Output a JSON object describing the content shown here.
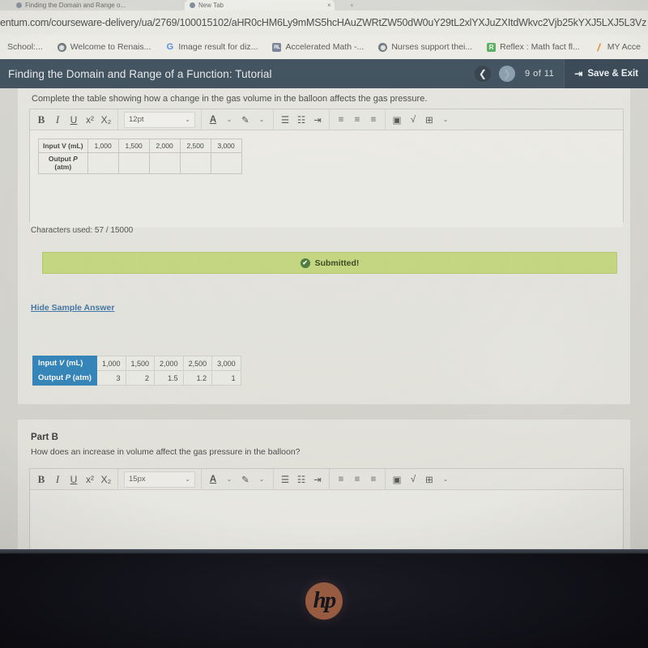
{
  "browser": {
    "tabs": [
      {
        "title": "Finding the Domain and Range o...",
        "active": false
      },
      {
        "title": "New Tab",
        "active": true
      }
    ],
    "url": "entum.com/courseware-delivery/ua/2769/100015102/aHR0cHM6Ly9mMS5hcHAuZWRtZW50dW0uY29tL2xlYXJuZXItdWkvc2Vjb25kYXJ5LXJ5L3Vz",
    "bookmarks": [
      {
        "label": "School:...",
        "icon": "none"
      },
      {
        "label": "Welcome to Renais...",
        "icon": "globe-icon"
      },
      {
        "label": "Image result for diz...",
        "icon": "google-icon"
      },
      {
        "label": "Accelerated Math -...",
        "icon": "renaissance-icon"
      },
      {
        "label": "Nurses support thei...",
        "icon": "globe-icon"
      },
      {
        "label": "Reflex : Math fact fl...",
        "icon": "reflex-icon"
      },
      {
        "label": "MY Acce",
        "icon": "slash-icon"
      }
    ]
  },
  "app_header": {
    "title": "Finding the Domain and Range of a Function: Tutorial",
    "back_icon": "chevron-left-icon",
    "next_icon": "chevron-right-icon",
    "page_count": "9 of 11",
    "save_label": "Save & Exit",
    "save_icon": "exit-icon",
    "bg_color": "#2e4355"
  },
  "part_a": {
    "prompt": "Complete the table showing how a change in the gas volume in the balloon affects the gas pressure.",
    "toolbar": {
      "bold": "B",
      "italic": "I",
      "underline": "U",
      "superscript": "x²",
      "subscript": "X₂",
      "font_size": "12pt",
      "text_color_icon": "text-color-icon",
      "highlight_icon": "highlight-icon",
      "bullet_list_icon": "bullet-list-icon",
      "numbered_list_icon": "numbered-list-icon",
      "indent_icon": "indent-icon",
      "align_left_icon": "align-left-icon",
      "align_center_icon": "align-center-icon",
      "align_right_icon": "align-right-icon",
      "image_icon": "insert-image-icon",
      "equation_icon": "insert-equation-icon",
      "table_icon": "insert-table-icon"
    },
    "editor_table": {
      "rows": [
        {
          "header": "Input V (mL)",
          "cells": [
            "1,000",
            "1,500",
            "2,000",
            "2,500",
            "3,000"
          ]
        },
        {
          "header": "Output P (atm)",
          "cells": [
            "",
            "",
            "",
            "",
            ""
          ]
        }
      ]
    },
    "character_count": "Characters used: 57 / 15000",
    "status_banner": {
      "label": "Submitted!",
      "icon": "check-circle-icon",
      "color": "#c3da72"
    },
    "hide_sample_link": "Hide Sample Answer",
    "answer_table": {
      "rows": [
        {
          "header": "Input V (mL)",
          "cells": [
            "1,000",
            "1,500",
            "2,000",
            "2,500",
            "3,000"
          ]
        },
        {
          "header": "Output P (atm)",
          "cells": [
            "3",
            "2",
            "1.5",
            "1.2",
            "1"
          ]
        }
      ],
      "header_color": "#1b81c4"
    }
  },
  "part_b": {
    "title": "Part B",
    "question": "How does an increase in volume affect the gas pressure in the balloon?",
    "toolbar": {
      "bold": "B",
      "italic": "I",
      "underline": "U",
      "superscript": "x²",
      "subscript": "X₂",
      "font_size": "15px"
    }
  },
  "device": {
    "brand_logo": "hp"
  }
}
